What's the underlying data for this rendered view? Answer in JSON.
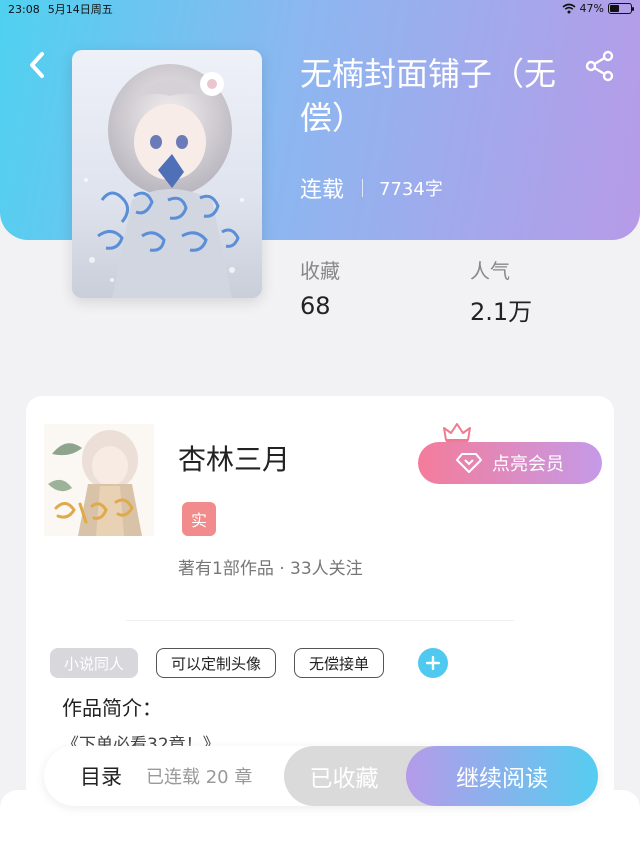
{
  "status_bar": {
    "time": "23:08",
    "date": "5月14日周五",
    "battery": "47%",
    "battery_level": 0.47
  },
  "book": {
    "title": "无楠封面铺子（无偿）",
    "status": "连载",
    "word_count": "7734字",
    "favorites_label": "收藏",
    "favorites_value": "68",
    "popularity_label": "人气",
    "popularity_value": "2.1万"
  },
  "author": {
    "name": "杏林三月",
    "real_badge": "实",
    "meta": "著有1部作品 · 33人关注",
    "member_button": "点亮会员"
  },
  "tags": [
    {
      "label": "小说同人",
      "style": "gray"
    },
    {
      "label": "可以定制头像",
      "style": "outline"
    },
    {
      "label": "无偿接单",
      "style": "outline"
    }
  ],
  "intro": {
    "title": "作品简介：",
    "text": "《下单必看32章！》"
  },
  "bottom_bar": {
    "toc_label": "目录",
    "toc_sub": "已连载 20 章",
    "collected_label": "已收藏",
    "read_label": "继续阅读"
  },
  "icons": {
    "back": "chevron-left-icon",
    "share": "share-icon",
    "crown": "crown-icon",
    "diamond": "diamond-icon",
    "wifi": "wifi-icon",
    "add": "plus-icon"
  },
  "colors": {
    "header_start": "#4fd1f0",
    "header_end": "#b79be8",
    "member_start": "#f47c9a",
    "read_start": "#b59be9",
    "read_end": "#55cdf0",
    "badge": "#f28b8b",
    "add_button": "#4fc9ef"
  }
}
